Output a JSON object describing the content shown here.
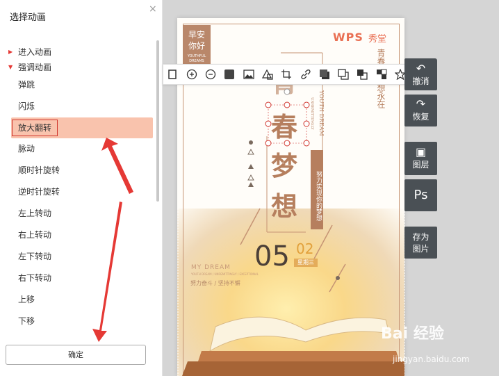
{
  "panel": {
    "title": "选择动画",
    "close": "×",
    "categories": [
      "进入动画",
      "强调动画"
    ],
    "items": [
      "弹跳",
      "闪烁",
      "放大翻转",
      "脉动",
      "顺时针旋转",
      "逆时针旋转",
      "左上转动",
      "右上转动",
      "左下转动",
      "右下转动",
      "上移",
      "下移"
    ],
    "selected_index": 2,
    "ok_label": "确定"
  },
  "poster": {
    "left_label_line1": "早安",
    "left_label_line2": "你好",
    "left_label_small1": "YOUTHFUL",
    "left_label_small2": "DREAMS",
    "logo": "WPS",
    "logo_sub": "秀堂",
    "chars": [
      "青",
      "春",
      "梦",
      "想"
    ],
    "right_vertical": "青春×梦想永在",
    "youth_dream": "YOUTH DREAM",
    "unremitting": "UNREMITTINGLY",
    "tag_vertical": "努力实现你的梦想",
    "day": "05",
    "day2": "02",
    "weekday": "星期三",
    "mydream": "MY DREAM",
    "mydream_sub": "YOUTH DREAM / UNREMITTINGLY / EXCEPTIONAL",
    "slogan": "努力奋斗 / 坚持不懈"
  },
  "toolbar": {
    "icons": [
      "crop-left-icon",
      "zoom-in-icon",
      "zoom-out-icon",
      "fill-color-icon",
      "image-icon",
      "shapes-icon",
      "crop-icon",
      "link-icon",
      "shadow-icon",
      "layer-copy-icon",
      "group-icon",
      "ungroup-icon",
      "star-icon",
      "document-icon"
    ]
  },
  "side": {
    "undo": "撤消",
    "redo": "恢复",
    "layers": "图层",
    "ps": "Ps",
    "save_image_line1": "存为",
    "save_image_line2": "图片"
  },
  "watermark": {
    "brand": "Bai  经验",
    "url": "jingyan.baidu.com"
  },
  "colors": {
    "selection_bg": "#f9c3ad",
    "selection_border": "#d0342c",
    "arrow": "#e53935",
    "accent": "#b67f5e"
  }
}
